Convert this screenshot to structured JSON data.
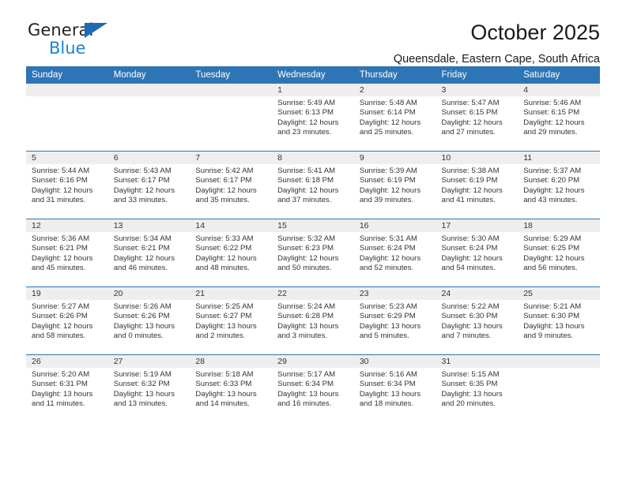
{
  "brand": {
    "name_dark": "General",
    "name_light": "Blue",
    "accent_dark": "#231f20",
    "accent_blue": "#1c83d4",
    "triangle_blue": "#1b6cb5"
  },
  "header": {
    "title": "October 2025",
    "subtitle": "Queensdale, Eastern Cape, South Africa",
    "header_bg": "#2e75b6",
    "daynum_bg": "#eeeeee"
  },
  "weekdays": [
    "Sunday",
    "Monday",
    "Tuesday",
    "Wednesday",
    "Thursday",
    "Friday",
    "Saturday"
  ],
  "weeks": [
    [
      {
        "day": "",
        "sunrise": "",
        "sunset": "",
        "daylight_line1": "",
        "daylight_line2": ""
      },
      {
        "day": "",
        "sunrise": "",
        "sunset": "",
        "daylight_line1": "",
        "daylight_line2": ""
      },
      {
        "day": "",
        "sunrise": "",
        "sunset": "",
        "daylight_line1": "",
        "daylight_line2": ""
      },
      {
        "day": "1",
        "sunrise": "Sunrise: 5:49 AM",
        "sunset": "Sunset: 6:13 PM",
        "daylight_line1": "Daylight: 12 hours",
        "daylight_line2": "and 23 minutes."
      },
      {
        "day": "2",
        "sunrise": "Sunrise: 5:48 AM",
        "sunset": "Sunset: 6:14 PM",
        "daylight_line1": "Daylight: 12 hours",
        "daylight_line2": "and 25 minutes."
      },
      {
        "day": "3",
        "sunrise": "Sunrise: 5:47 AM",
        "sunset": "Sunset: 6:15 PM",
        "daylight_line1": "Daylight: 12 hours",
        "daylight_line2": "and 27 minutes."
      },
      {
        "day": "4",
        "sunrise": "Sunrise: 5:46 AM",
        "sunset": "Sunset: 6:15 PM",
        "daylight_line1": "Daylight: 12 hours",
        "daylight_line2": "and 29 minutes."
      }
    ],
    [
      {
        "day": "5",
        "sunrise": "Sunrise: 5:44 AM",
        "sunset": "Sunset: 6:16 PM",
        "daylight_line1": "Daylight: 12 hours",
        "daylight_line2": "and 31 minutes."
      },
      {
        "day": "6",
        "sunrise": "Sunrise: 5:43 AM",
        "sunset": "Sunset: 6:17 PM",
        "daylight_line1": "Daylight: 12 hours",
        "daylight_line2": "and 33 minutes."
      },
      {
        "day": "7",
        "sunrise": "Sunrise: 5:42 AM",
        "sunset": "Sunset: 6:17 PM",
        "daylight_line1": "Daylight: 12 hours",
        "daylight_line2": "and 35 minutes."
      },
      {
        "day": "8",
        "sunrise": "Sunrise: 5:41 AM",
        "sunset": "Sunset: 6:18 PM",
        "daylight_line1": "Daylight: 12 hours",
        "daylight_line2": "and 37 minutes."
      },
      {
        "day": "9",
        "sunrise": "Sunrise: 5:39 AM",
        "sunset": "Sunset: 6:19 PM",
        "daylight_line1": "Daylight: 12 hours",
        "daylight_line2": "and 39 minutes."
      },
      {
        "day": "10",
        "sunrise": "Sunrise: 5:38 AM",
        "sunset": "Sunset: 6:19 PM",
        "daylight_line1": "Daylight: 12 hours",
        "daylight_line2": "and 41 minutes."
      },
      {
        "day": "11",
        "sunrise": "Sunrise: 5:37 AM",
        "sunset": "Sunset: 6:20 PM",
        "daylight_line1": "Daylight: 12 hours",
        "daylight_line2": "and 43 minutes."
      }
    ],
    [
      {
        "day": "12",
        "sunrise": "Sunrise: 5:36 AM",
        "sunset": "Sunset: 6:21 PM",
        "daylight_line1": "Daylight: 12 hours",
        "daylight_line2": "and 45 minutes."
      },
      {
        "day": "13",
        "sunrise": "Sunrise: 5:34 AM",
        "sunset": "Sunset: 6:21 PM",
        "daylight_line1": "Daylight: 12 hours",
        "daylight_line2": "and 46 minutes."
      },
      {
        "day": "14",
        "sunrise": "Sunrise: 5:33 AM",
        "sunset": "Sunset: 6:22 PM",
        "daylight_line1": "Daylight: 12 hours",
        "daylight_line2": "and 48 minutes."
      },
      {
        "day": "15",
        "sunrise": "Sunrise: 5:32 AM",
        "sunset": "Sunset: 6:23 PM",
        "daylight_line1": "Daylight: 12 hours",
        "daylight_line2": "and 50 minutes."
      },
      {
        "day": "16",
        "sunrise": "Sunrise: 5:31 AM",
        "sunset": "Sunset: 6:24 PM",
        "daylight_line1": "Daylight: 12 hours",
        "daylight_line2": "and 52 minutes."
      },
      {
        "day": "17",
        "sunrise": "Sunrise: 5:30 AM",
        "sunset": "Sunset: 6:24 PM",
        "daylight_line1": "Daylight: 12 hours",
        "daylight_line2": "and 54 minutes."
      },
      {
        "day": "18",
        "sunrise": "Sunrise: 5:29 AM",
        "sunset": "Sunset: 6:25 PM",
        "daylight_line1": "Daylight: 12 hours",
        "daylight_line2": "and 56 minutes."
      }
    ],
    [
      {
        "day": "19",
        "sunrise": "Sunrise: 5:27 AM",
        "sunset": "Sunset: 6:26 PM",
        "daylight_line1": "Daylight: 12 hours",
        "daylight_line2": "and 58 minutes."
      },
      {
        "day": "20",
        "sunrise": "Sunrise: 5:26 AM",
        "sunset": "Sunset: 6:26 PM",
        "daylight_line1": "Daylight: 13 hours",
        "daylight_line2": "and 0 minutes."
      },
      {
        "day": "21",
        "sunrise": "Sunrise: 5:25 AM",
        "sunset": "Sunset: 6:27 PM",
        "daylight_line1": "Daylight: 13 hours",
        "daylight_line2": "and 2 minutes."
      },
      {
        "day": "22",
        "sunrise": "Sunrise: 5:24 AM",
        "sunset": "Sunset: 6:28 PM",
        "daylight_line1": "Daylight: 13 hours",
        "daylight_line2": "and 3 minutes."
      },
      {
        "day": "23",
        "sunrise": "Sunrise: 5:23 AM",
        "sunset": "Sunset: 6:29 PM",
        "daylight_line1": "Daylight: 13 hours",
        "daylight_line2": "and 5 minutes."
      },
      {
        "day": "24",
        "sunrise": "Sunrise: 5:22 AM",
        "sunset": "Sunset: 6:30 PM",
        "daylight_line1": "Daylight: 13 hours",
        "daylight_line2": "and 7 minutes."
      },
      {
        "day": "25",
        "sunrise": "Sunrise: 5:21 AM",
        "sunset": "Sunset: 6:30 PM",
        "daylight_line1": "Daylight: 13 hours",
        "daylight_line2": "and 9 minutes."
      }
    ],
    [
      {
        "day": "26",
        "sunrise": "Sunrise: 5:20 AM",
        "sunset": "Sunset: 6:31 PM",
        "daylight_line1": "Daylight: 13 hours",
        "daylight_line2": "and 11 minutes."
      },
      {
        "day": "27",
        "sunrise": "Sunrise: 5:19 AM",
        "sunset": "Sunset: 6:32 PM",
        "daylight_line1": "Daylight: 13 hours",
        "daylight_line2": "and 13 minutes."
      },
      {
        "day": "28",
        "sunrise": "Sunrise: 5:18 AM",
        "sunset": "Sunset: 6:33 PM",
        "daylight_line1": "Daylight: 13 hours",
        "daylight_line2": "and 14 minutes."
      },
      {
        "day": "29",
        "sunrise": "Sunrise: 5:17 AM",
        "sunset": "Sunset: 6:34 PM",
        "daylight_line1": "Daylight: 13 hours",
        "daylight_line2": "and 16 minutes."
      },
      {
        "day": "30",
        "sunrise": "Sunrise: 5:16 AM",
        "sunset": "Sunset: 6:34 PM",
        "daylight_line1": "Daylight: 13 hours",
        "daylight_line2": "and 18 minutes."
      },
      {
        "day": "31",
        "sunrise": "Sunrise: 5:15 AM",
        "sunset": "Sunset: 6:35 PM",
        "daylight_line1": "Daylight: 13 hours",
        "daylight_line2": "and 20 minutes."
      },
      {
        "day": "",
        "sunrise": "",
        "sunset": "",
        "daylight_line1": "",
        "daylight_line2": ""
      }
    ]
  ]
}
